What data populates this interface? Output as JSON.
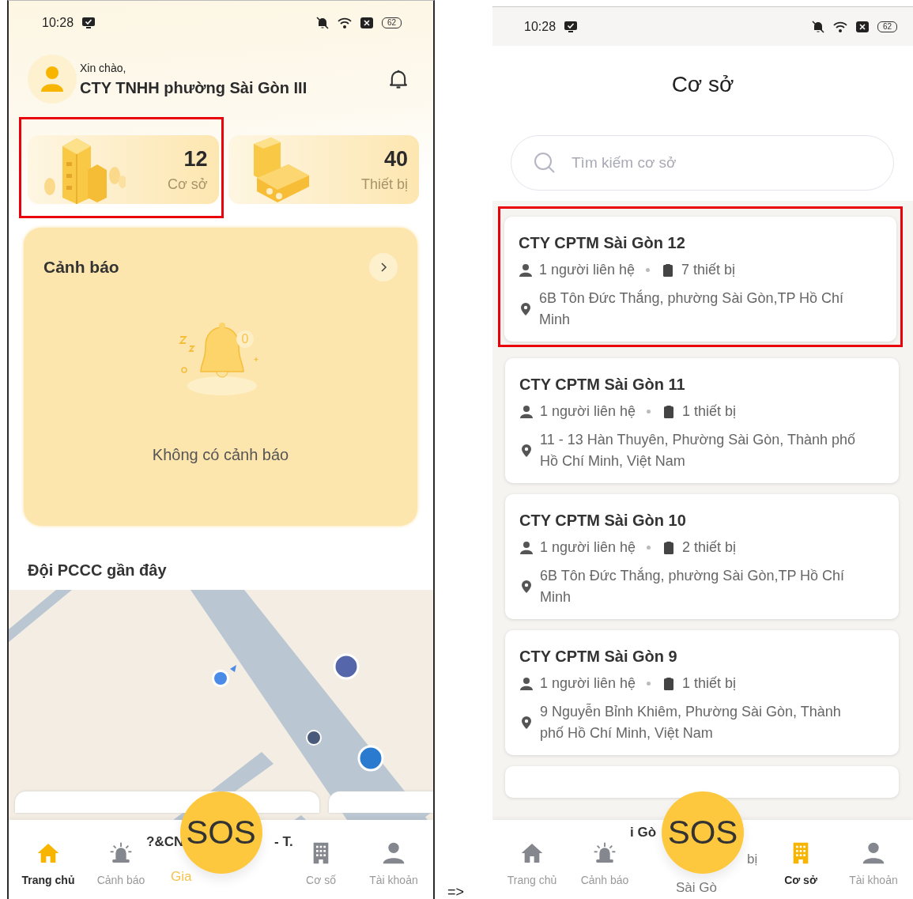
{
  "home_screen": {
    "status_bar": {
      "time": "10:28",
      "battery": "62"
    },
    "greeting": {
      "label": "Xin chào,",
      "name": "CTY TNHH phường Sài Gòn III"
    },
    "stats": [
      {
        "kind": "building",
        "value": "12",
        "label": "Cơ sở",
        "highlighted": true
      },
      {
        "kind": "device",
        "value": "40",
        "label": "Thiết bị",
        "highlighted": false
      }
    ],
    "alerts": {
      "title": "Cảnh báo",
      "badge": "0",
      "empty_text": "Không có cảnh báo"
    },
    "nearby": {
      "title": "Đội PCCC gần đây",
      "peek_texts": [
        "?&CN",
        "- T.",
        "Gia"
      ]
    },
    "sos": "SOS",
    "nav": [
      {
        "kind": "home",
        "label": "Trang chủ",
        "selected": true
      },
      {
        "kind": "alarm",
        "label": "Cảnh báo",
        "selected": false
      },
      {
        "kind": "building",
        "label": "Cơ số",
        "selected": false
      },
      {
        "kind": "account",
        "label": "Tài khoản",
        "selected": false
      }
    ]
  },
  "arrow": "=>",
  "facilities_screen": {
    "status_bar": {
      "time": "10:28",
      "battery": "62"
    },
    "title": "Cơ sở",
    "search": {
      "placeholder": "Tìm kiếm cơ sở"
    },
    "items": [
      {
        "name": "CTY CPTM Sài Gòn 12",
        "contacts": "1 người liên hệ",
        "devices": "7 thiết bị",
        "address": "6B Tôn Đức Thắng, phường Sài Gòn,TP Hồ Chí Minh",
        "highlighted": true
      },
      {
        "name": "CTY CPTM Sài Gòn 11",
        "contacts": "1 người liên hệ",
        "devices": "1 thiết bị",
        "address": "11 - 13 Hàn Thuyên, Phường Sài Gòn, Thành phố Hồ Chí Minh, Việt Nam",
        "highlighted": false
      },
      {
        "name": "CTY CPTM Sài Gòn 10",
        "contacts": "1 người liên hệ",
        "devices": "2 thiết bị",
        "address": "6B Tôn Đức Thắng, phường Sài Gòn,TP Hồ Chí Minh",
        "highlighted": false
      },
      {
        "name": "CTY CPTM Sài Gòn 9",
        "contacts": "1 người liên hệ",
        "devices": "1 thiết bị",
        "address": "9 Nguyễn Bỉnh Khiêm, Phường Sài Gòn, Thành phố Hồ Chí Minh, Việt Nam",
        "highlighted": false
      }
    ],
    "peek_texts": [
      "i Gò",
      "bị",
      "Sài Gò"
    ],
    "sos": "SOS",
    "nav": [
      {
        "kind": "home",
        "label": "Trang chủ",
        "selected": false
      },
      {
        "kind": "alarm",
        "label": "Cảnh báo",
        "selected": false
      },
      {
        "kind": "building",
        "label": "Cơ sở",
        "selected": true
      },
      {
        "kind": "account",
        "label": "Tài khoản",
        "selected": false
      }
    ]
  }
}
